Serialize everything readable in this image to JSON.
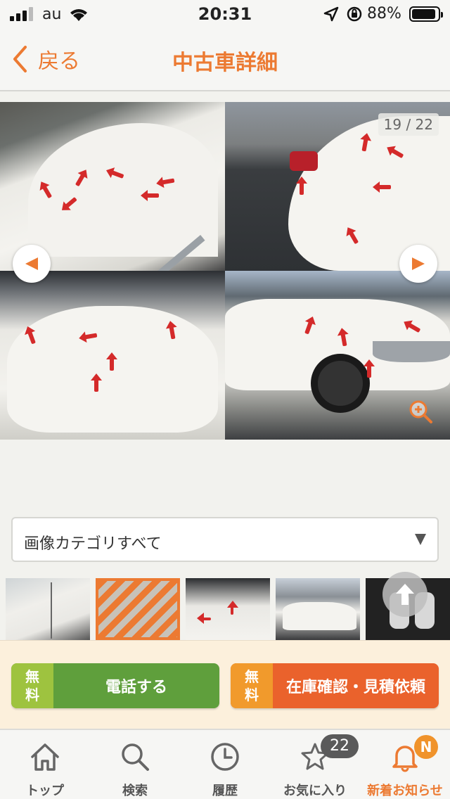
{
  "status_bar": {
    "carrier": "au",
    "time": "20:31",
    "battery_percent": "88%"
  },
  "nav": {
    "back_label": "戻る",
    "title": "中古車詳細"
  },
  "gallery": {
    "counter": "19 / 22"
  },
  "category_select": {
    "value": "画像カテゴリすべて"
  },
  "actions": {
    "call": {
      "free_line1": "無",
      "free_line2": "料",
      "label": "電話する"
    },
    "quote": {
      "free_line1": "無",
      "free_line2": "料",
      "label": "在庫確認・見積依頼"
    }
  },
  "tabbar": {
    "items": [
      {
        "label": "トップ",
        "icon": "home-icon"
      },
      {
        "label": "検索",
        "icon": "search-icon"
      },
      {
        "label": "履歴",
        "icon": "clock-icon"
      },
      {
        "label": "お気に入り",
        "icon": "star-icon"
      },
      {
        "label": "新着お知らせ",
        "icon": "bell-icon"
      }
    ],
    "favorites_badge": "22",
    "new_badge": "N"
  },
  "colors": {
    "accent": "#ec7a32",
    "call_green": "#5f9f3c",
    "quote_orange": "#ea622c"
  }
}
